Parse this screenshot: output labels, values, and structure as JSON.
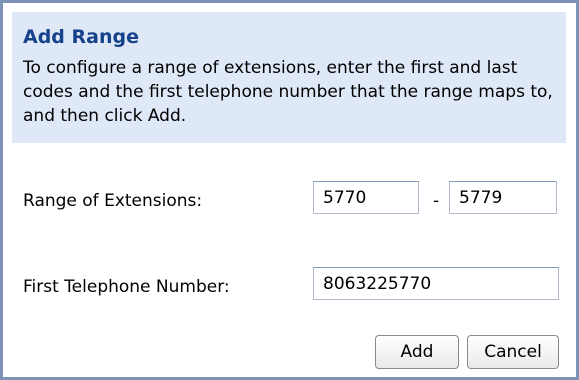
{
  "dialog": {
    "title": "Add Range",
    "description": "To configure a range of extensions, enter the first and last codes and the first telephone number that the range maps to, and then click Add."
  },
  "range": {
    "label": "Range of Extensions:",
    "start_value": "5770",
    "separator": "-",
    "end_value": "5779"
  },
  "phone": {
    "label": "First Telephone Number:",
    "value": "8063225770"
  },
  "buttons": {
    "add_label": "Add",
    "cancel_label": "Cancel"
  }
}
